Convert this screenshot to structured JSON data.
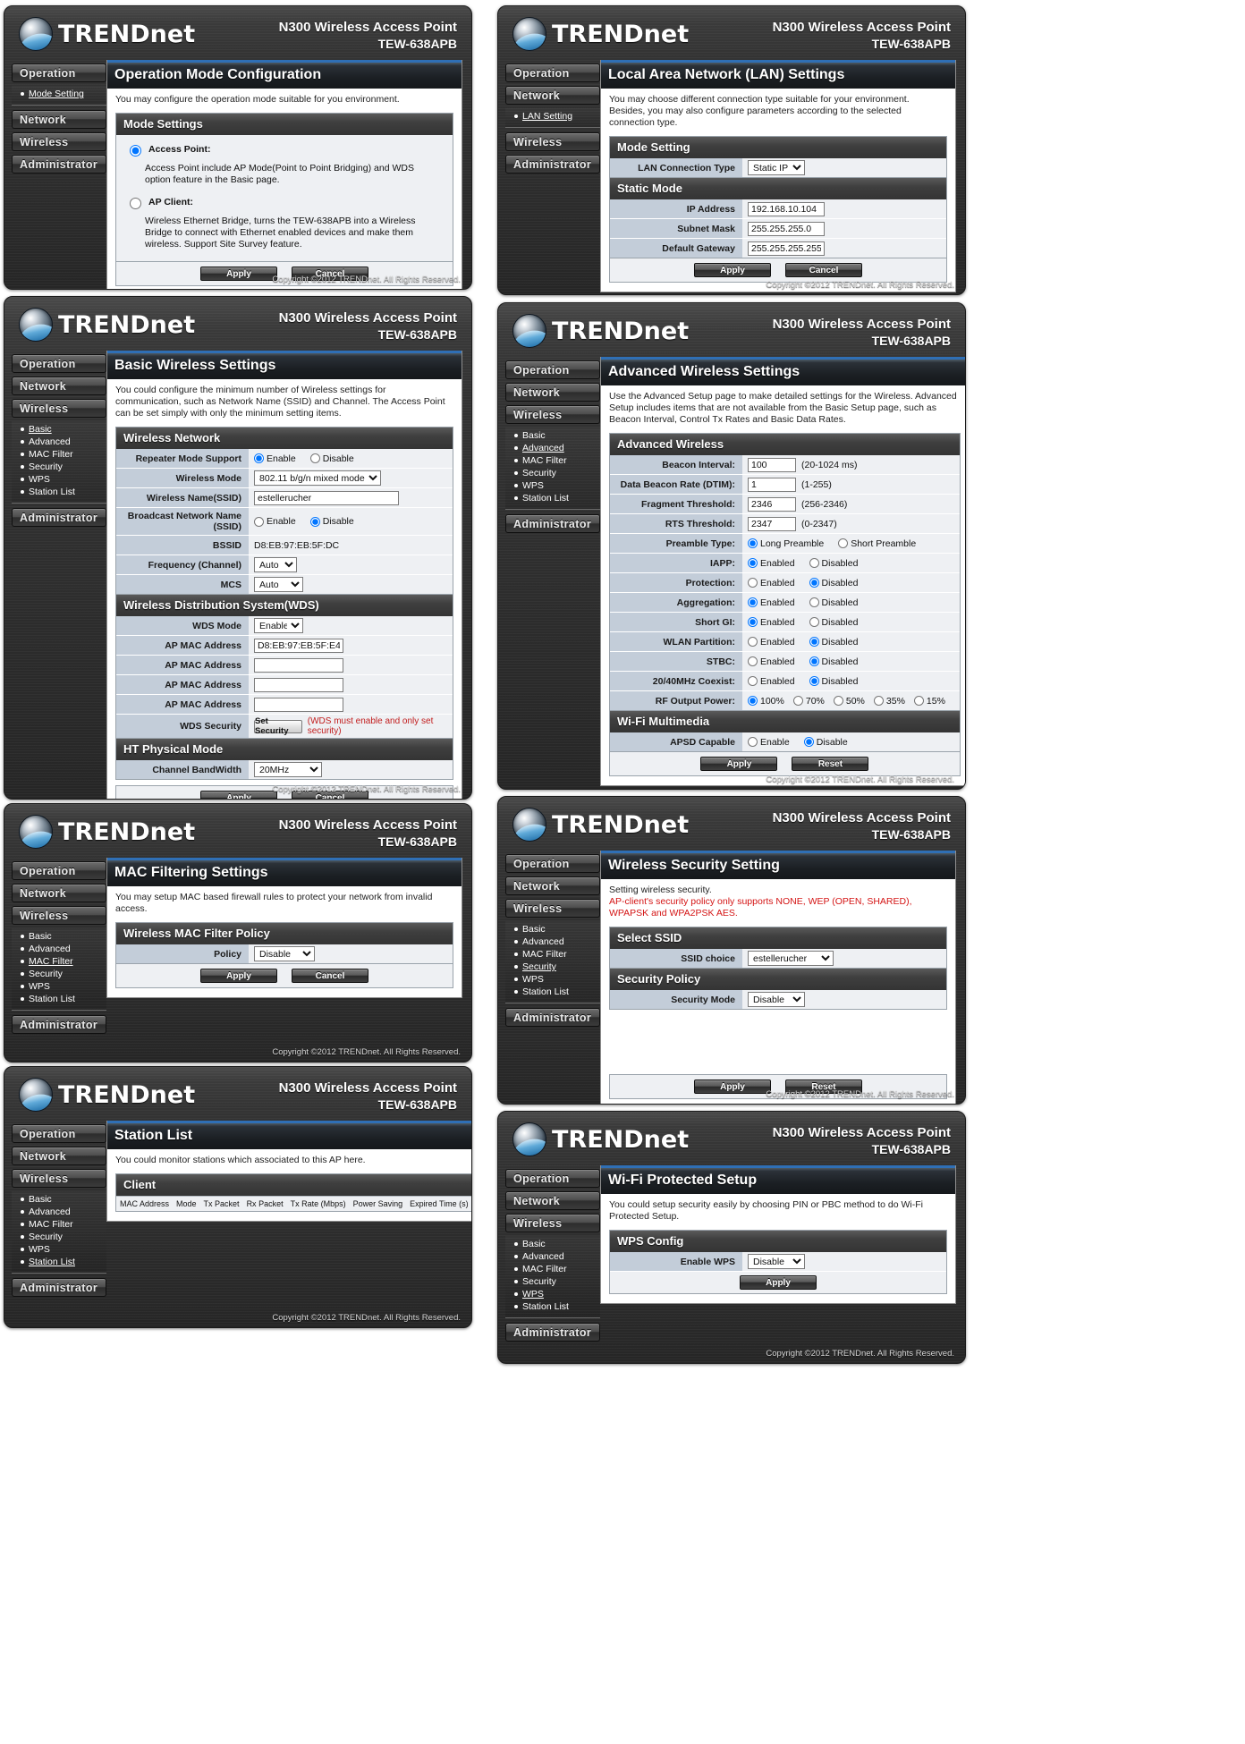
{
  "brand": {
    "name": "TRENDnet",
    "product": "N300 Wireless Access Point",
    "model": "TEW-638APB",
    "copyright": "Copyright ©2012 TRENDnet. All Rights Reserved."
  },
  "nav": {
    "operation": "Operation",
    "network": "Network",
    "wireless": "Wireless",
    "administrator": "Administrator",
    "sub": {
      "mode_setting": "Mode Setting",
      "lan_setting": "LAN Setting",
      "basic": "Basic",
      "advanced": "Advanced",
      "mac_filter": "MAC Filter",
      "security": "Security",
      "wps": "WPS",
      "station_list": "Station List"
    }
  },
  "buttons": {
    "apply": "Apply",
    "cancel": "Cancel",
    "reset": "Reset",
    "set_security": "Set Security"
  },
  "pages": {
    "operation": {
      "title": "Operation Mode Configuration",
      "intro": "You may configure the operation mode suitable for you environment.",
      "section": "Mode Settings",
      "options": [
        {
          "label": "Access Point:",
          "selected": true,
          "desc": "Access Point include AP Mode(Point to Point Bridging) and WDS option feature in the Basic page."
        },
        {
          "label": "AP Client:",
          "selected": false,
          "desc": "Wireless Ethernet Bridge, turns the TEW-638APB into a Wireless Bridge to connect with Ethernet enabled devices and make them wireless. Support Site Survey feature."
        }
      ]
    },
    "lan": {
      "title": "Local Area Network (LAN) Settings",
      "intro": "You may choose different connection type suitable for your environment. Besides, you may also configure parameters according to the selected connection type.",
      "mode_section": "Mode Setting",
      "conn_type_label": "LAN Connection Type",
      "conn_type_value": "Static IP",
      "static_section": "Static Mode",
      "fields": [
        {
          "label": "IP Address",
          "value": "192.168.10.104"
        },
        {
          "label": "Subnet Mask",
          "value": "255.255.255.0"
        },
        {
          "label": "Default Gateway",
          "value": "255.255.255.255"
        }
      ]
    },
    "basic": {
      "title": "Basic Wireless Settings",
      "intro": "You could configure the minimum number of Wireless settings for communication, such as Network Name (SSID) and Channel. The Access Point can be set simply with only the minimum setting items.",
      "wireless_network": {
        "header": "Wireless Network",
        "repeater_label": "Repeater Mode Support",
        "repeater_enable": "Enable",
        "repeater_disable": "Disable",
        "repeater_value": "Enable",
        "mode_label": "Wireless Mode",
        "mode_value": "802.11 b/g/n mixed mode",
        "ssid_label": "Wireless Name(SSID)",
        "ssid_value": "estellerucher",
        "broadcast_label": "Broadcast Network Name (SSID)",
        "broadcast_enable": "Enable",
        "broadcast_disable": "Disable",
        "broadcast_value": "Disable",
        "bssid_label": "BSSID",
        "bssid_value": "D8:EB:97:EB:5F:DC",
        "freq_label": "Frequency (Channel)",
        "freq_value": "Auto",
        "mcs_label": "MCS",
        "mcs_value": "Auto"
      },
      "wds": {
        "header": "Wireless Distribution System(WDS)",
        "mode_label": "WDS Mode",
        "mode_value": "Enable",
        "ap_mac_label": "AP MAC Address",
        "ap_macs": [
          "D8:EB:97:EB:5F:E4",
          "",
          "",
          ""
        ],
        "security_label": "WDS Security",
        "security_button": "Set Security",
        "security_hint": "(WDS must enable and only set security)"
      },
      "ht": {
        "header": "HT Physical Mode",
        "bandwidth_label": "Channel BandWidth",
        "bandwidth_value": "20MHz"
      }
    },
    "advanced": {
      "title": "Advanced Wireless Settings",
      "intro": "Use the Advanced Setup page to make detailed settings for the Wireless. Advanced Setup includes items that are not available from the Basic Setup page, such as Beacon Interval, Control Tx Rates and Basic Data Rates.",
      "section": "Advanced Wireless",
      "text_fields": [
        {
          "label": "Beacon Interval:",
          "value": "100",
          "note": "(20-1024 ms)"
        },
        {
          "label": "Data Beacon Rate (DTIM):",
          "value": "1",
          "note": "(1-255)"
        },
        {
          "label": "Fragment Threshold:",
          "value": "2346",
          "note": "(256-2346)"
        },
        {
          "label": "RTS Threshold:",
          "value": "2347",
          "note": "(0-2347)"
        }
      ],
      "radio_rows": [
        {
          "label": "Preamble Type:",
          "options": [
            "Long Preamble",
            "Short Preamble"
          ],
          "selected": 0
        },
        {
          "label": "IAPP:",
          "options": [
            "Enabled",
            "Disabled"
          ],
          "selected": 0
        },
        {
          "label": "Protection:",
          "options": [
            "Enabled",
            "Disabled"
          ],
          "selected": 1
        },
        {
          "label": "Aggregation:",
          "options": [
            "Enabled",
            "Disabled"
          ],
          "selected": 0
        },
        {
          "label": "Short GI:",
          "options": [
            "Enabled",
            "Disabled"
          ],
          "selected": 0
        },
        {
          "label": "WLAN Partition:",
          "options": [
            "Enabled",
            "Disabled"
          ],
          "selected": 1
        },
        {
          "label": "STBC:",
          "options": [
            "Enabled",
            "Disabled"
          ],
          "selected": 1
        },
        {
          "label": "20/40MHz Coexist:",
          "options": [
            "Enabled",
            "Disabled"
          ],
          "selected": 1
        },
        {
          "label": "RF Output Power:",
          "options": [
            "100%",
            "70%",
            "50%",
            "35%",
            "15%"
          ],
          "selected": 0
        }
      ],
      "wmm": {
        "header": "Wi-Fi Multimedia",
        "apsd_label": "APSD Capable",
        "options": [
          "Enable",
          "Disable"
        ],
        "selected": 1
      }
    },
    "mac": {
      "title": "MAC Filtering Settings",
      "intro": "You may setup MAC based firewall rules to protect your network from invalid access.",
      "section": "Wireless MAC Filter Policy",
      "policy_label": "Policy",
      "policy_value": "Disable"
    },
    "security": {
      "title": "Wireless Security Setting",
      "intro_line1": "Setting wireless security.",
      "intro_line2": "AP-client's security policy only supports NONE, WEP (OPEN, SHARED), WPAPSK and WPA2PSK AES.",
      "ssid_section": "Select SSID",
      "ssid_label": "SSID choice",
      "ssid_value": "estellerucher",
      "policy_section": "Security Policy",
      "mode_label": "Security Mode",
      "mode_value": "Disable"
    },
    "station": {
      "title": "Station List",
      "intro": "You could monitor stations which associated to this AP here.",
      "section": "Client",
      "columns": [
        "MAC Address",
        "Mode",
        "Tx Packet",
        "Rx Packet",
        "Tx Rate (Mbps)",
        "Power Saving",
        "Expired Time (s)"
      ],
      "rows": []
    },
    "wps": {
      "title": "Wi-Fi Protected Setup",
      "intro": "You could setup security easily by choosing PIN or PBC method to do Wi-Fi Protected Setup.",
      "section": "WPS Config",
      "enable_label": "Enable WPS",
      "enable_value": "Disable"
    }
  }
}
